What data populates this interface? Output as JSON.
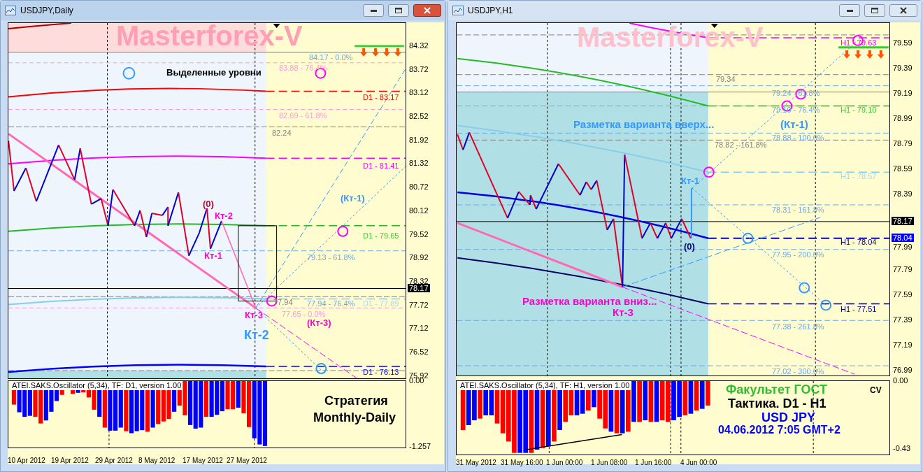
{
  "windows": [
    {
      "title": "USDJPY,Daily",
      "active": true,
      "labels": [
        {
          "text": "Masterforex-V",
          "kind": "watermark",
          "color": "#ff9eb5"
        },
        {
          "text": "Выделенные уровни",
          "kind": "bold",
          "color": "#000000"
        },
        {
          "text": "84.17 - 0.0%",
          "kind": "plain",
          "color": "#6fa8dc"
        },
        {
          "text": "83.88 - 76.4%",
          "kind": "plain",
          "color": "#ff99dd"
        },
        {
          "text": "D1 - 83.17",
          "kind": "plain",
          "color": "#ff0000"
        },
        {
          "text": "82.69 - 61.8%",
          "kind": "plain",
          "color": "#ff99dd"
        },
        {
          "text": "82.24",
          "kind": "plain",
          "color": "#808080"
        },
        {
          "text": "D1 - 81.41",
          "kind": "plain",
          "color": "#ff00ff"
        },
        {
          "text": "(0)",
          "kind": "bold",
          "color": "#cc0033"
        },
        {
          "text": "Кт-2",
          "kind": "bold",
          "color": "#ff00cc"
        },
        {
          "text": "(Кт-1)",
          "kind": "bold",
          "color": "#3399ff"
        },
        {
          "text": "D1 - 79.65",
          "kind": "plain",
          "color": "#33cc33"
        },
        {
          "text": "Кт-1",
          "kind": "bold",
          "color": "#ff00cc"
        },
        {
          "text": "79.13 - 61.8%",
          "kind": "plain",
          "color": "#6fa8dc"
        },
        {
          "text": "77.94",
          "kind": "plain",
          "color": "#808080"
        },
        {
          "text": "77.94 - 76.4%",
          "kind": "plain",
          "color": "#6fa8dc"
        },
        {
          "text": "D1 - 77.89",
          "kind": "plain",
          "color": "#a8d8ea"
        },
        {
          "text": "Кт-3",
          "kind": "bold",
          "color": "#ff00cc"
        },
        {
          "text": "77.65 - 0.0%",
          "kind": "plain",
          "color": "#ff99dd"
        },
        {
          "text": "(Кт-3)",
          "kind": "bold",
          "color": "#ff00cc"
        },
        {
          "text": "Кт-2",
          "kind": "large",
          "color": "#3399ff"
        },
        {
          "text": "D1 - 76.13",
          "kind": "plain",
          "color": "#0000ff"
        }
      ],
      "price_axis": [
        "84.32",
        "83.72",
        "83.12",
        "82.52",
        "81.92",
        "81.32",
        "80.72",
        "80.12",
        "79.52",
        "78.92",
        "78.32",
        "77.72",
        "77.12",
        "76.52",
        "75.92"
      ],
      "price_tags": [
        {
          "text": "78.17",
          "color": "#000000"
        }
      ],
      "oscillator": {
        "title": "ATEI.SAKS.Oscillator (5,34), TF: D1, version 1.00",
        "captions": [
          {
            "text": "Стратегия",
            "color": "#000000"
          },
          {
            "text": "Monthly-Daily",
            "color": "#000000"
          }
        ],
        "axis_labels": [
          "0.00",
          "-1.257"
        ]
      },
      "time_axis": [
        "10 Apr 2012",
        "19 Apr 2012",
        "29 Apr 2012",
        "8 May 2012",
        "17 May 2012",
        "27 May 2012"
      ]
    },
    {
      "title": "USDJPY,H1",
      "active": false,
      "labels": [
        {
          "text": "Masterforex-V",
          "kind": "watermark",
          "color": "#ffc0cb"
        },
        {
          "text": "H1 - 79.63",
          "kind": "plain",
          "color": "#ff00ff"
        },
        {
          "text": "79.34",
          "kind": "plain",
          "color": "#808080"
        },
        {
          "text": "79.24 - 61.8%",
          "kind": "plain",
          "color": "#6fa8dc"
        },
        {
          "text": "79.10 - 76.4%",
          "kind": "plain",
          "color": "#6fa8dc"
        },
        {
          "text": "H1 - 79.10",
          "kind": "plain",
          "color": "#33cc33"
        },
        {
          "text": "Разметка варианта вверх...",
          "kind": "heading",
          "color": "#3399ff"
        },
        {
          "text": "(Кт-1)",
          "kind": "heading",
          "color": "#3399ff"
        },
        {
          "text": "78.88 - 100.0%",
          "kind": "plain",
          "color": "#6fa8dc"
        },
        {
          "text": "78.82 - 161.8%",
          "kind": "plain",
          "color": "#808080"
        },
        {
          "text": "H1 - 78.57",
          "kind": "plain",
          "color": "#a8d8ea"
        },
        {
          "text": "Кт-1",
          "kind": "bold",
          "color": "#3399ff"
        },
        {
          "text": "78.31 - 161.8%",
          "kind": "plain",
          "color": "#6fa8dc"
        },
        {
          "text": "(0)",
          "kind": "bold",
          "color": "#000080"
        },
        {
          "text": "H1 - 78.04",
          "kind": "plain",
          "color": "#000080"
        },
        {
          "text": "77.95 - 200.0%",
          "kind": "plain",
          "color": "#6fa8dc"
        },
        {
          "text": "Разметка варианта вниз...",
          "kind": "heading",
          "color": "#ff00cc"
        },
        {
          "text": "Кт-3",
          "kind": "heading",
          "color": "#ff00cc"
        },
        {
          "text": "H1 - 77.51",
          "kind": "plain",
          "color": "#000080"
        },
        {
          "text": "77.38 - 261.8%",
          "kind": "plain",
          "color": "#6fa8dc"
        },
        {
          "text": "77.02 - 300.0%",
          "kind": "plain",
          "color": "#6fa8dc"
        }
      ],
      "price_axis": [
        "79.59",
        "79.39",
        "79.19",
        "78.99",
        "78.79",
        "78.59",
        "78.39",
        "77.99",
        "77.79",
        "77.59",
        "77.39",
        "77.19",
        "76.99"
      ],
      "price_tags": [
        {
          "text": "78.17",
          "color": "#000000"
        },
        {
          "text": "78.04",
          "color": "#0000ff"
        }
      ],
      "oscillator": {
        "title": "ATEI.SAKS.Oscillator (5,34), TF: H1, version 1.00",
        "captions": [
          {
            "text": "Факультет ГОСТ",
            "color": "#33bb33"
          },
          {
            "text": "CV",
            "color": "#000000"
          },
          {
            "text": "Тактика. D1 - H1",
            "color": "#000000"
          },
          {
            "text": "USD JPY",
            "color": "#0000ff"
          },
          {
            "text": "04.06.2012 7:05 GMT+2",
            "color": "#0000ff"
          }
        ],
        "axis_labels": [
          "0.00",
          "-0.43"
        ]
      },
      "time_axis": [
        "31 May 2012",
        "31 May 16:00",
        "1 Jun 00:00",
        "1 Jun 08:00",
        "1 Jun 16:00",
        "4 Jun 00:00"
      ]
    }
  ]
}
